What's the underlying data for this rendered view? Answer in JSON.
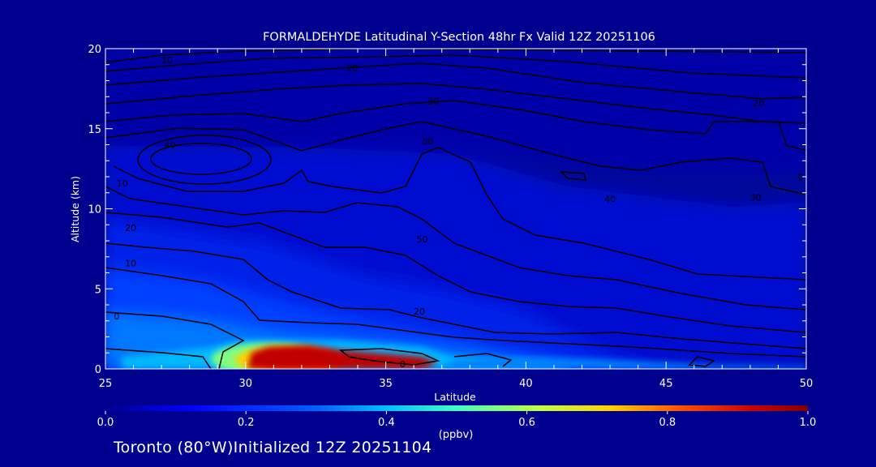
{
  "chart_data": {
    "type": "heatmap",
    "title": "FORMALDEHYDE Latitudinal Y-Section 48hr  Fx Valid 12Z 20251106",
    "xlabel": "Latitude",
    "ylabel": "Altitude (km)",
    "xlim": [
      25,
      50
    ],
    "ylim": [
      0,
      20
    ],
    "x_ticks": [
      "25",
      "30",
      "35",
      "40",
      "45",
      "50"
    ],
    "y_ticks": [
      "0",
      "5",
      "10",
      "15",
      "20"
    ],
    "colorbar": {
      "label": "(ppbv)",
      "range": [
        0.0,
        1.0
      ],
      "ticks": [
        "0.0",
        "0.2",
        "0.4",
        "0.6",
        "0.8",
        "1.0"
      ]
    },
    "field_max_region": {
      "lat_range": [
        30.5,
        37
      ],
      "alt_range": [
        0,
        1.5
      ],
      "value": 1.0
    },
    "contour_labels": [
      {
        "text": "10",
        "lat": 27.2,
        "alt": 19.3
      },
      {
        "text": "20",
        "lat": 33.8,
        "alt": 18.8
      },
      {
        "text": "30",
        "lat": 36.7,
        "alt": 16.7
      },
      {
        "text": "20",
        "lat": 48.3,
        "alt": 16.6
      },
      {
        "text": "40",
        "lat": 27.3,
        "alt": 14.0
      },
      {
        "text": "50",
        "lat": 36.5,
        "alt": 14.2
      },
      {
        "text": "10",
        "lat": 25.6,
        "alt": 11.6
      },
      {
        "text": "40",
        "lat": 43.0,
        "alt": 10.6
      },
      {
        "text": "30",
        "lat": 48.2,
        "alt": 10.7
      },
      {
        "text": "0",
        "lat": 49.8,
        "alt": 12.0
      },
      {
        "text": "20",
        "lat": 25.9,
        "alt": 8.8
      },
      {
        "text": "50",
        "lat": 36.3,
        "alt": 8.1
      },
      {
        "text": "10",
        "lat": 25.9,
        "alt": 6.6
      },
      {
        "text": "0",
        "lat": 25.4,
        "alt": 3.3
      },
      {
        "text": "20",
        "lat": 36.2,
        "alt": 3.6
      },
      {
        "text": "0",
        "lat": 35.6,
        "alt": 0.3
      }
    ]
  },
  "footer": "Toronto (80°W)Initialized 12Z 20251104"
}
